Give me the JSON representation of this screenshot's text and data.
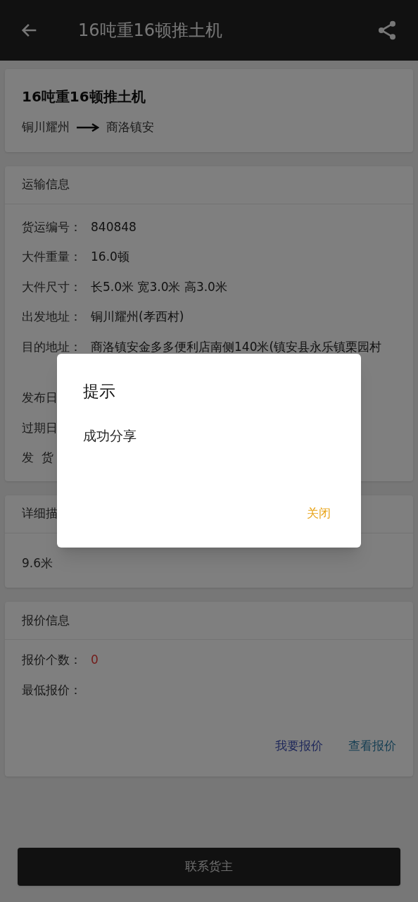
{
  "app_bar": {
    "title": "16吨重16顿推土机"
  },
  "summary": {
    "title": "16吨重16顿推土机",
    "from": "铜川耀州",
    "to": "商洛镇安"
  },
  "transport": {
    "heading": "运输信息",
    "rows": [
      {
        "label": "货运编号：",
        "value": "840848"
      },
      {
        "label": "大件重量：",
        "value": "16.0顿"
      },
      {
        "label": "大件尺寸：",
        "value": "长5.0米 宽3.0米 高3.0米"
      },
      {
        "label": "出发地址：",
        "value": "铜川耀州(孝西村)"
      },
      {
        "label": "目的地址：",
        "value": "商洛镇安金多多便利店南侧140米(镇安县永乐镇栗园村"
      }
    ],
    "date_rows": [
      {
        "label": "发布日"
      },
      {
        "label": "过期日"
      },
      {
        "label": "发  货"
      }
    ]
  },
  "details": {
    "heading": "详细描",
    "text": "9.6米"
  },
  "quotes": {
    "heading": "报价信息",
    "rows": [
      {
        "label": "报价个数：",
        "value": "0",
        "kind": "alert"
      },
      {
        "label": "最低报价："
      }
    ],
    "links": [
      "我要报价",
      "查看报价"
    ]
  },
  "contact_button": "联系货主",
  "dialog": {
    "title": "提示",
    "message": "成功分享",
    "close": "关闭"
  }
}
